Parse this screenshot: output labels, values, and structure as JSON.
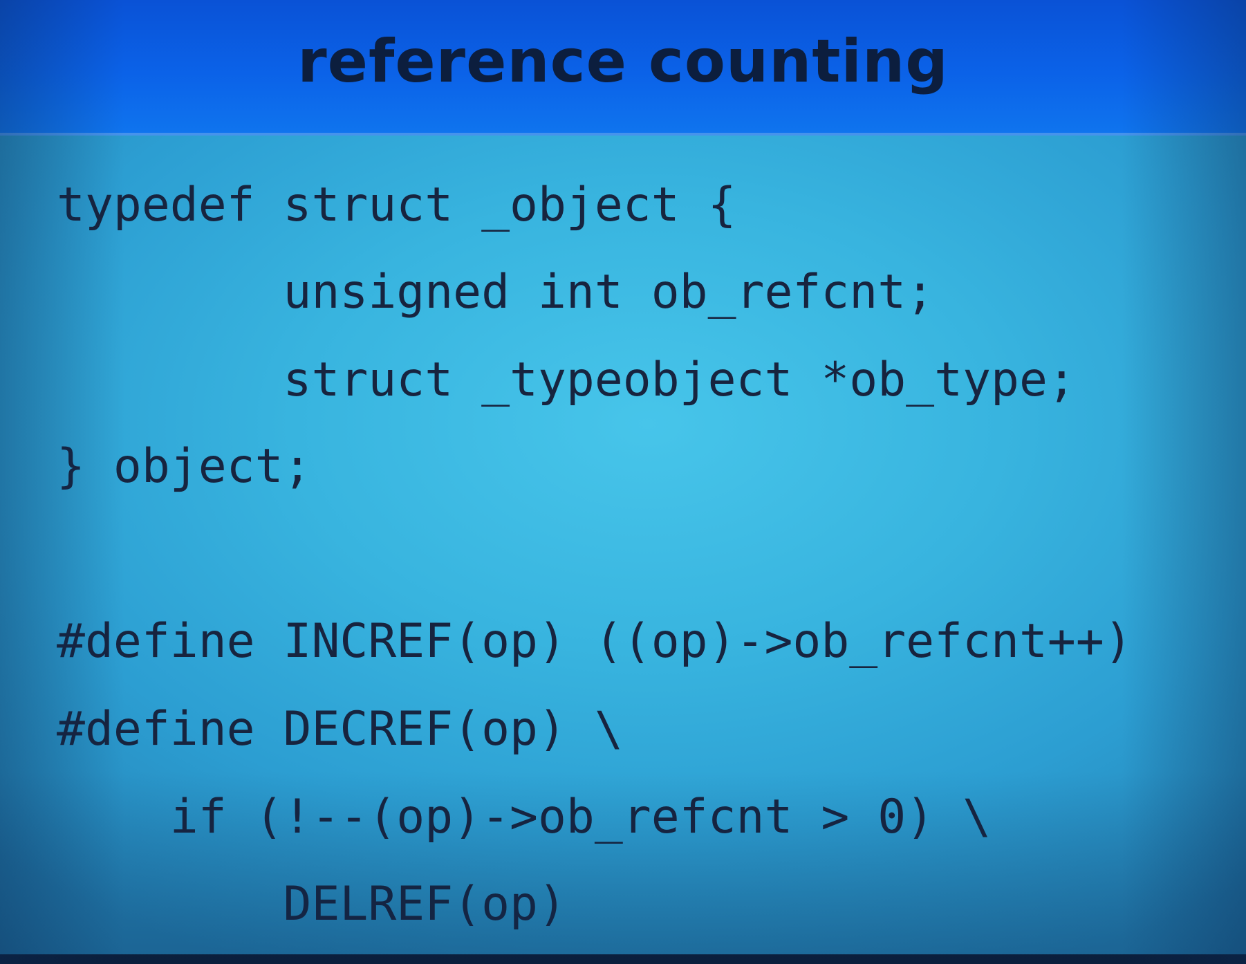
{
  "slide": {
    "title": "reference counting",
    "code_lines": [
      "typedef struct _object {",
      "        unsigned int ob_refcnt;",
      "        struct _typeobject *ob_type;",
      "} object;",
      "",
      "#define INCREF(op) ((op)->ob_refcnt++)",
      "#define DECREF(op) \\",
      "    if (!--(op)->ob_refcnt > 0) \\",
      "        DELREF(op)"
    ]
  },
  "colors": {
    "header_blue": "#0b62e8",
    "background_cyan": "#3fbde6",
    "text_dark": "#17243f"
  }
}
